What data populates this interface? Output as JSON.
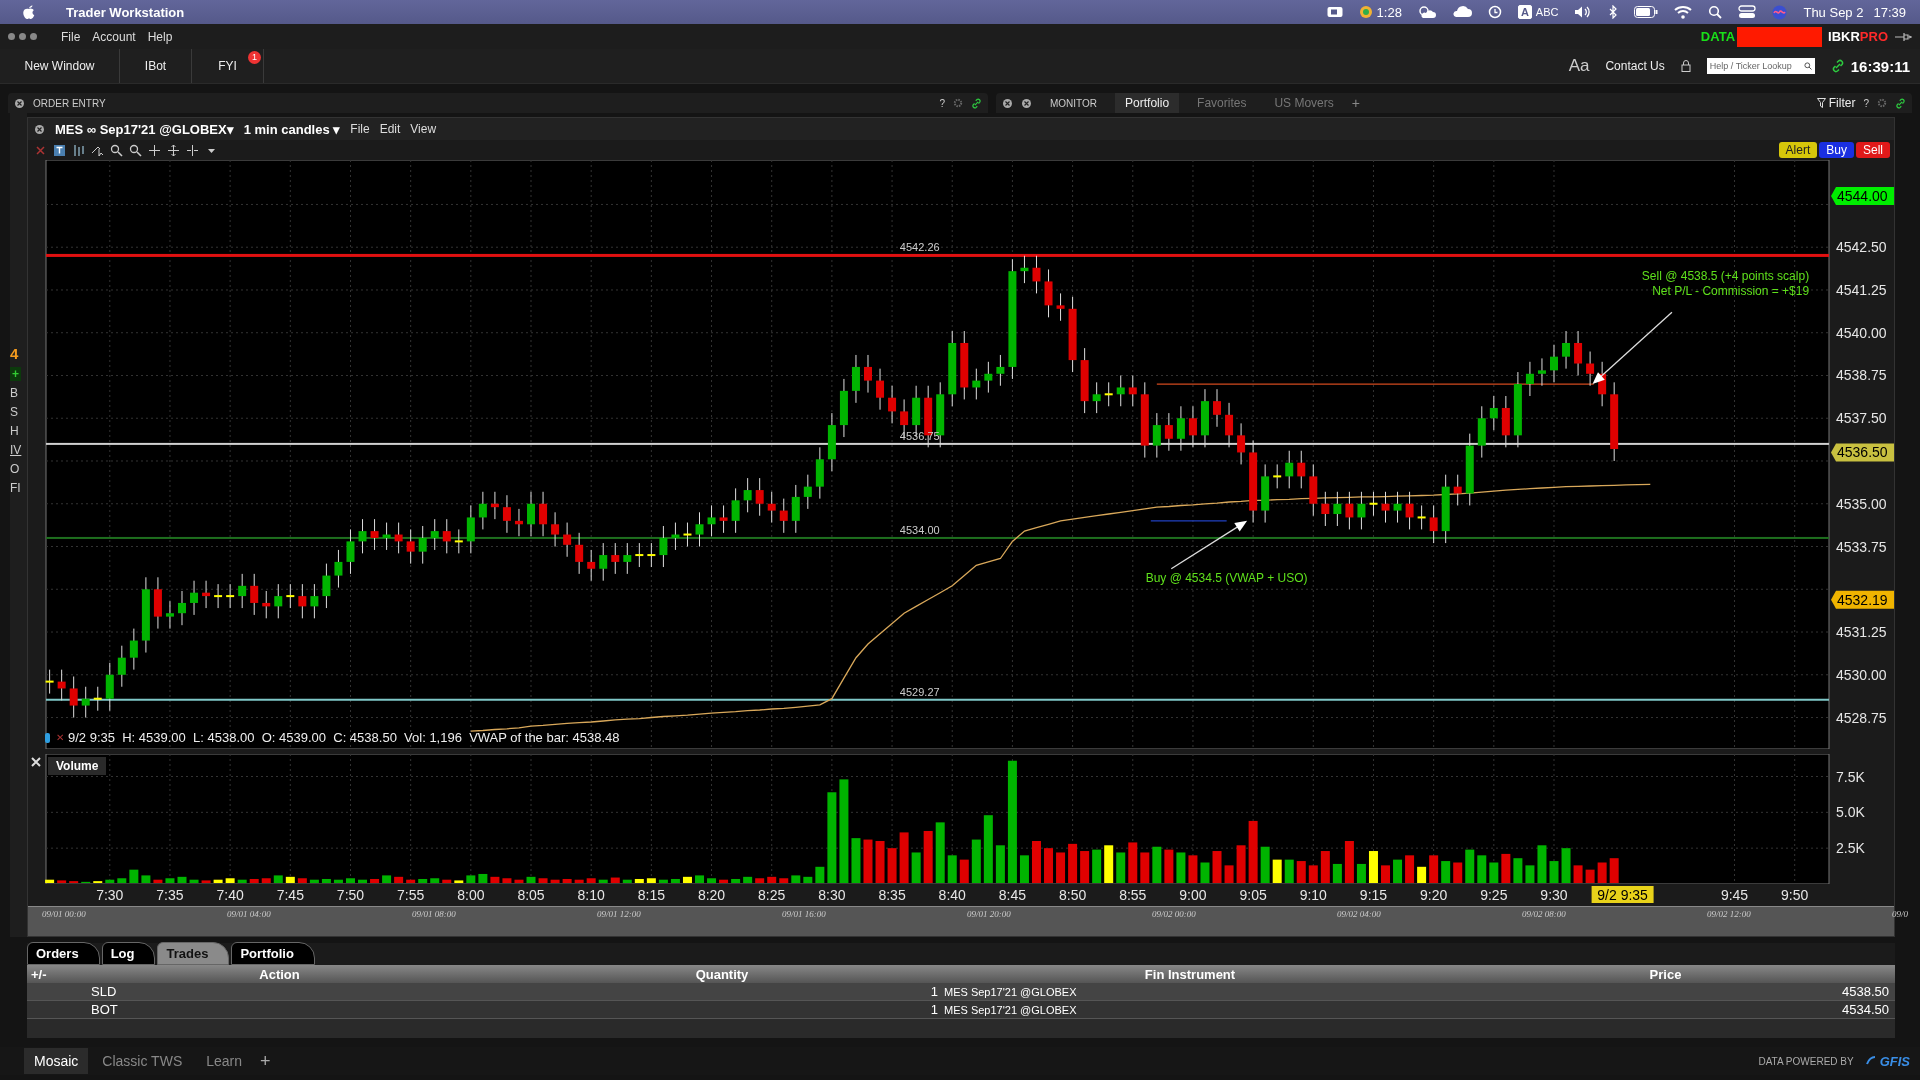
{
  "menubar": {
    "app": "Trader Workstation",
    "timer": "1:28",
    "input_badge": "A",
    "input_name": "ABC",
    "date": "Thu Sep 2",
    "time": "17:39"
  },
  "app_menu": {
    "items": [
      "File",
      "Account",
      "Help"
    ],
    "data_label": "DATA",
    "logo_main": "IBKR",
    "logo_accent": "PRO"
  },
  "toolbar": {
    "buttons": [
      {
        "label": "New Window"
      },
      {
        "label": "IBot"
      },
      {
        "label": "FYI",
        "badge": "1"
      }
    ],
    "font_button": "Aa",
    "contact": "Contact Us",
    "search_placeholder": "Help / Ticker Lookup",
    "clock": "16:39:11"
  },
  "order_entry": {
    "title": "ORDER ENTRY",
    "help": "?",
    "fragments": [
      {
        "label": "4",
        "kind": "price"
      },
      {
        "label": "+",
        "kind": "add"
      },
      {
        "label": "B",
        "kind": "text"
      },
      {
        "label": "S",
        "kind": "text"
      },
      {
        "label": "H",
        "kind": "text"
      },
      {
        "label": "IV",
        "kind": "link"
      },
      {
        "label": "O",
        "kind": "text"
      },
      {
        "label": "FI",
        "kind": "text"
      }
    ]
  },
  "monitor": {
    "title": "MONITOR",
    "tabs": [
      {
        "label": "Portfolio",
        "selected": true
      },
      {
        "label": "Favorites",
        "selected": false
      },
      {
        "label": "US Movers",
        "selected": false
      }
    ],
    "add": "+",
    "filter": "Filter",
    "help": "?"
  },
  "chart_window": {
    "symbol": "MES ∞ Sep17'21 @GLOBEX▾",
    "interval": "1 min candles ▾",
    "menus": [
      "File",
      "Edit",
      "View"
    ],
    "order_buttons": [
      {
        "label": "Alert",
        "kind": "alert"
      },
      {
        "label": "Buy",
        "kind": "buy"
      },
      {
        "label": "Sell",
        "kind": "sell"
      }
    ],
    "price_axis_labels": [
      "4542.50",
      "4541.25",
      "4540.00",
      "4538.75",
      "4537.50",
      "4535.00",
      "4533.75",
      "4531.25",
      "4530.00",
      "4528.75"
    ],
    "price_levels": [
      {
        "label": "4542.26",
        "color": "#e01010"
      },
      {
        "label": "4536.75",
        "color": "#d0d0d0"
      },
      {
        "label": "4534.00",
        "color": "#1e6e1e"
      },
      {
        "label": "4529.27",
        "color": "#7fc8c8"
      }
    ],
    "price_tags": [
      {
        "label": "4544.00",
        "color": "#00ee00"
      },
      {
        "label": "4536.50",
        "color": "#c8c040"
      },
      {
        "label": "4532.19",
        "color": "#f0b400"
      }
    ],
    "notes": [
      {
        "kind": "buy",
        "lines": [
          "Buy @ 4534.5 (VWAP + USO)"
        ]
      },
      {
        "kind": "sell",
        "lines": [
          "Sell @ 4538.5 (+4 points scalp)",
          "Net P/L - Commission = +$19"
        ]
      }
    ],
    "info_close": "✕",
    "info": "9/2 9:35  H: 4539.00  L: 4538.00  O: 4539.00  C: 4538.50  Vol: 1,196  VWAP of the bar: 4538.48",
    "volume": {
      "title": "Volume",
      "axis_labels": [
        "7.5K",
        "5.0K",
        "2.5K"
      ]
    },
    "time_labels": [
      "7:30",
      "7:35",
      "7:40",
      "7:45",
      "7:50",
      "7:55",
      "8:00",
      "8:05",
      "8:10",
      "8:15",
      "8:20",
      "8:25",
      "8:30",
      "8:35",
      "8:40",
      "8:45",
      "8:50",
      "8:55",
      "9:00",
      "9:05",
      "9:10",
      "9:15",
      "9:20",
      "9:25",
      "9:30",
      "9:45",
      "9:50"
    ],
    "time_tag": "9/2 9:35",
    "overview_labels": [
      "09/01 00:00",
      "09/01 04:00",
      "09/01 08:00",
      "09/01 12:00",
      "09/01 16:00",
      "09/01 20:00",
      "09/02 00:00",
      "09/02 04:00",
      "09/02 08:00",
      "09/02 12:00",
      "09/0"
    ]
  },
  "trades": {
    "tabs": [
      {
        "label": "Orders",
        "selected": false
      },
      {
        "label": "Log",
        "selected": false
      },
      {
        "label": "Trades",
        "selected": true
      },
      {
        "label": "Portfolio",
        "selected": false
      }
    ],
    "columns": [
      "+/-",
      "Action",
      "Quantity",
      "Fin Instrument",
      "Price"
    ],
    "rows": [
      {
        "action": "SLD",
        "quantity": "1",
        "instrument": "MES Sep17'21 @GLOBEX",
        "price": "4538.50"
      },
      {
        "action": "BOT",
        "quantity": "1",
        "instrument": "MES Sep17'21 @GLOBEX",
        "price": "4534.50"
      }
    ]
  },
  "bottom": {
    "tabs": [
      {
        "label": "Mosaic",
        "selected": true
      },
      {
        "label": "Classic TWS",
        "selected": false
      },
      {
        "label": "Learn",
        "selected": false
      }
    ],
    "add": "+",
    "powered_by": "DATA POWERED BY",
    "brand": "GFIS"
  }
}
